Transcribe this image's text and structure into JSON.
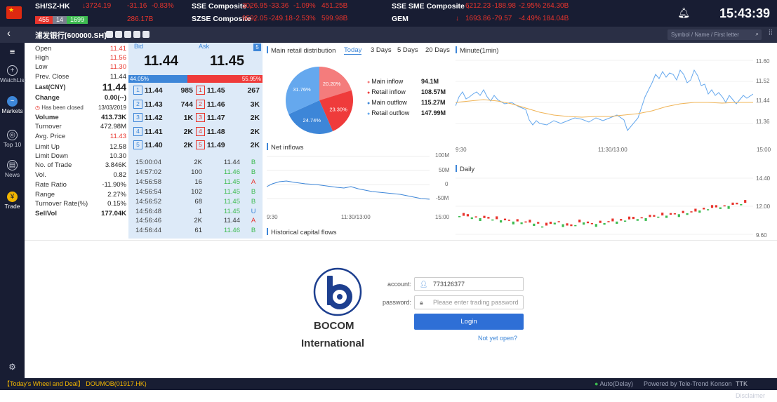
{
  "topbar": {
    "markets": [
      {
        "name": "SH/SZ-HK",
        "value": "3724.19",
        "change": "-31.16",
        "pct": "-0.83%",
        "up": "455",
        "flat": "14",
        "down": "1699",
        "turnover": "286.17B"
      },
      {
        "name": "SSE Composite",
        "value": "3026.95",
        "change": "-33.36",
        "pct": "-1.09%",
        "turnover": "451.25B"
      },
      {
        "name": "SZSE Composite",
        "value": "9592.05",
        "change": "-249.18",
        "pct": "-2.53%",
        "turnover": "599.98B"
      },
      {
        "name": "SSE SME Composite",
        "value": "6212.23",
        "change": "-188.98",
        "pct": "-2.95%",
        "turnover": "264.30B"
      },
      {
        "name": "GEM",
        "value": "1693.86",
        "change": "-79.57",
        "pct": "-4.49%",
        "turnover": "184.04B"
      }
    ],
    "clock": "15:43:39"
  },
  "secbar": {
    "stock": "浦发银行[600000.SH]",
    "search_placeholder": "Symbol / Name / First letter"
  },
  "nav": [
    {
      "label": "WatchList",
      "icon": "plus-circle-icon"
    },
    {
      "label": "Markets",
      "icon": "chart-wave-icon"
    },
    {
      "label": "Top 10",
      "icon": "trophy-icon"
    },
    {
      "label": "News",
      "icon": "news-icon"
    },
    {
      "label": "Trade",
      "icon": "trade-coin-icon"
    }
  ],
  "quote": [
    {
      "k": "Open",
      "v": "11.41",
      "c": "#e8342c"
    },
    {
      "k": "High",
      "v": "11.56",
      "c": "#e8342c"
    },
    {
      "k": "Low",
      "v": "11.30",
      "c": "#e8342c"
    },
    {
      "k": "Prev. Close",
      "v": "11.44",
      "c": "#222"
    },
    {
      "k": "Last(CNY)",
      "v": "11.44",
      "c": "#222",
      "big": true
    },
    {
      "k": "Change",
      "v": "0.00(--)",
      "c": "#222",
      "bold": true
    },
    {
      "k": "Has been closed",
      "v": "13/03/2019",
      "c": "#222",
      "closed": true
    },
    {
      "k": "Volume",
      "v": "413.73K",
      "c": "#222",
      "bold": true
    },
    {
      "k": "Turnover",
      "v": "472.98M",
      "c": "#222"
    },
    {
      "k": "Avg. Price",
      "v": "11.43",
      "c": "#e8342c"
    },
    {
      "k": "Limit Up",
      "v": "12.58",
      "c": "#222"
    },
    {
      "k": "Limit Down",
      "v": "10.30",
      "c": "#222"
    },
    {
      "k": "No. of Trade",
      "v": "3.846K",
      "c": "#222"
    },
    {
      "k": "Vol.",
      "v": "0.82",
      "c": "#222"
    },
    {
      "k": "Rate Ratio",
      "v": "-11.90%",
      "c": "#222"
    },
    {
      "k": "Range",
      "v": "2.27%",
      "c": "#222"
    },
    {
      "k": "Turnover Rate(%)",
      "v": "0.15%",
      "c": "#222"
    },
    {
      "k": "SellVol",
      "v": "177.04K",
      "c": "#222",
      "bold": true
    }
  ],
  "bidask": {
    "bid_label": "Bid",
    "ask_label": "Ask",
    "depth": "5",
    "bid": "11.44",
    "ask": "11.45",
    "bid_pct": "44.05%",
    "ask_pct": "55.95%",
    "bid_ratio": 0.4405,
    "levels": [
      {
        "lvl": "1",
        "bp": "11.44",
        "bv": "985",
        "ap": "11.45",
        "av": "267"
      },
      {
        "lvl": "2",
        "bp": "11.43",
        "bv": "744",
        "ap": "11.46",
        "av": "3K"
      },
      {
        "lvl": "3",
        "bp": "11.42",
        "bv": "1K",
        "ap": "11.47",
        "av": "2K"
      },
      {
        "lvl": "4",
        "bp": "11.41",
        "bv": "2K",
        "ap": "11.48",
        "av": "2K"
      },
      {
        "lvl": "5",
        "bp": "11.40",
        "bv": "2K",
        "ap": "11.49",
        "av": "2K"
      }
    ],
    "ticks": [
      {
        "t": "15:00:04",
        "v": "2K",
        "p": "11.44",
        "s": "B"
      },
      {
        "t": "14:57:02",
        "v": "100",
        "p": "11.46",
        "s": "B"
      },
      {
        "t": "14:56:58",
        "v": "16",
        "p": "11.45",
        "s": "A"
      },
      {
        "t": "14:56:54",
        "v": "102",
        "p": "11.45",
        "s": "B"
      },
      {
        "t": "14:56:52",
        "v": "68",
        "p": "11.45",
        "s": "B"
      },
      {
        "t": "14:56:48",
        "v": "1",
        "p": "11.45",
        "s": "U"
      },
      {
        "t": "14:56:46",
        "v": "2K",
        "p": "11.44",
        "s": "A"
      },
      {
        "t": "14:56:44",
        "v": "61",
        "p": "11.46",
        "s": "B"
      }
    ]
  },
  "retail": {
    "title": "Main retail distribution",
    "tabs": [
      "Today",
      "3 Days",
      "5 Days",
      "20 Days"
    ],
    "legend": [
      {
        "name": "Main inflow",
        "val": "94.1M",
        "color": "#f47c7c"
      },
      {
        "name": "Retail inflow",
        "val": "108.57M",
        "color": "#ef3b3b"
      },
      {
        "name": "Main outflow",
        "val": "115.27M",
        "color": "#3d86d8"
      },
      {
        "name": "Retail outflow",
        "val": "147.99M",
        "color": "#65a8ee"
      }
    ],
    "pie": [
      {
        "label": "20.20%",
        "value": 20.2,
        "color": "#f47c7c"
      },
      {
        "label": "23.30%",
        "value": 23.3,
        "color": "#ef3b3b"
      },
      {
        "label": "24.74%",
        "value": 24.74,
        "color": "#3d86d8"
      },
      {
        "label": "31.76%",
        "value": 31.76,
        "color": "#65a8ee"
      }
    ]
  },
  "netinflow": {
    "title": "Net inflows",
    "yticks": [
      "100M",
      "50M",
      "0",
      "-50M"
    ],
    "xticks": [
      "9:30",
      "11:30/13:00",
      "15:00"
    ]
  },
  "hist_title": "Historical capital flows",
  "minute": {
    "title": "Minute(1min)",
    "yticks": [
      "11.60",
      "11.52",
      "11.44",
      "11.36"
    ],
    "xticks": [
      "9:30",
      "11:30/13:00",
      "15:00"
    ]
  },
  "daily": {
    "title": "Daily",
    "yticks": [
      "14.40",
      "12.00",
      "9.60"
    ]
  },
  "login": {
    "brand1": "BOCOM",
    "brand2": "International",
    "account_label": "account:",
    "account_value": "773126377",
    "password_label": "password:",
    "password_placeholder": "Please enter trading password",
    "login_button": "Login",
    "not_yet_open": "Not yet open?"
  },
  "footer": {
    "ticker": "【Today's Wheel and Deal】 DOUMOB(01917.HK)",
    "status": "Auto(Delay)",
    "powered": "Powered by Tele-Trend Konson",
    "disclaimer": "TTK Disclaimer"
  },
  "colors": {
    "up": "#e8342c",
    "down": "#3dbb50",
    "accent": "#3d86d8",
    "navbg": "#181d33"
  }
}
